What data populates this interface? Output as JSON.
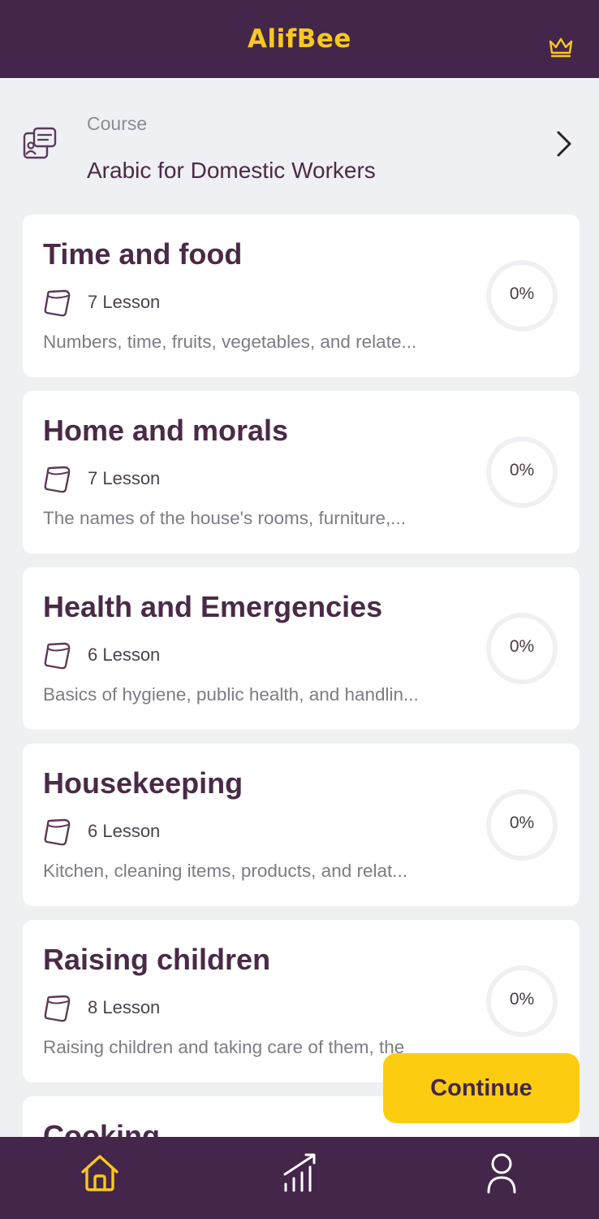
{
  "app": {
    "title": "AlifBee"
  },
  "course": {
    "caption": "Course",
    "name": "Arabic for Domestic Workers"
  },
  "units": [
    {
      "title": "Time and food",
      "lessons": "7 Lesson",
      "description": "Numbers, time, fruits, vegetables, and relate...",
      "progress": "0%",
      "progress_value": 0
    },
    {
      "title": "Home and morals",
      "lessons": "7 Lesson",
      "description": "The names of the house's rooms, furniture,...",
      "progress": "0%",
      "progress_value": 0
    },
    {
      "title": "Health and Emergencies",
      "lessons": "6 Lesson",
      "description": "Basics of hygiene, public health, and handlin...",
      "progress": "0%",
      "progress_value": 0
    },
    {
      "title": "Housekeeping",
      "lessons": "6 Lesson",
      "description": "Kitchen, cleaning items,  products, and relat...",
      "progress": "0%",
      "progress_value": 0
    },
    {
      "title": "Raising children",
      "lessons": "8 Lesson",
      "description": "Raising children and taking care of them, the",
      "progress": "0%",
      "progress_value": 0
    },
    {
      "title": "Cooking"
    }
  ],
  "continue_label": "Continue",
  "nav": {
    "items": [
      "home-icon",
      "stats-icon",
      "profile-icon"
    ],
    "active": "home-icon"
  },
  "colors": {
    "brand": "#43264a",
    "accent": "#fccc10",
    "background": "#eef0f4"
  }
}
